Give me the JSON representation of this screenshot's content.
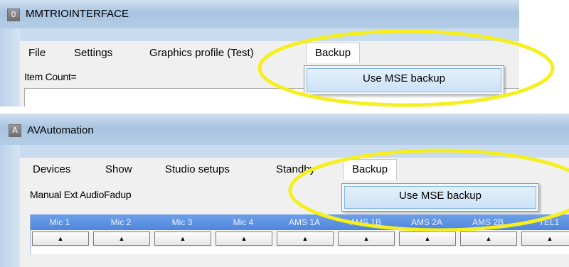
{
  "window1": {
    "icon_glyph": "0",
    "title": "MMTRIOINTERFACE",
    "menu": {
      "file": "File",
      "settings": "Settings",
      "graphics_profile": "Graphics profile (Test)",
      "backup": "Backup"
    },
    "item_count_label": "Item Count=",
    "dropdown_item": "Use MSE backup"
  },
  "window2": {
    "icon_glyph": "A",
    "title": "AVAutomation",
    "menu": {
      "devices": "Devices",
      "show": "Show",
      "studio_setups": "Studio setups",
      "standby": "Standby",
      "backup": "Backup"
    },
    "label": "Manual Ext AudioFadup",
    "dropdown_item": "Use MSE backup",
    "columns": [
      "Mic 1",
      "Mic 2",
      "Mic 3",
      "Mic 4",
      "AMS 1A",
      "AMS 1B",
      "AMS 2A",
      "AMS 2B",
      "TEL1"
    ],
    "arrow_glyph": "▲"
  },
  "highlight_color": "#f6ef1f"
}
